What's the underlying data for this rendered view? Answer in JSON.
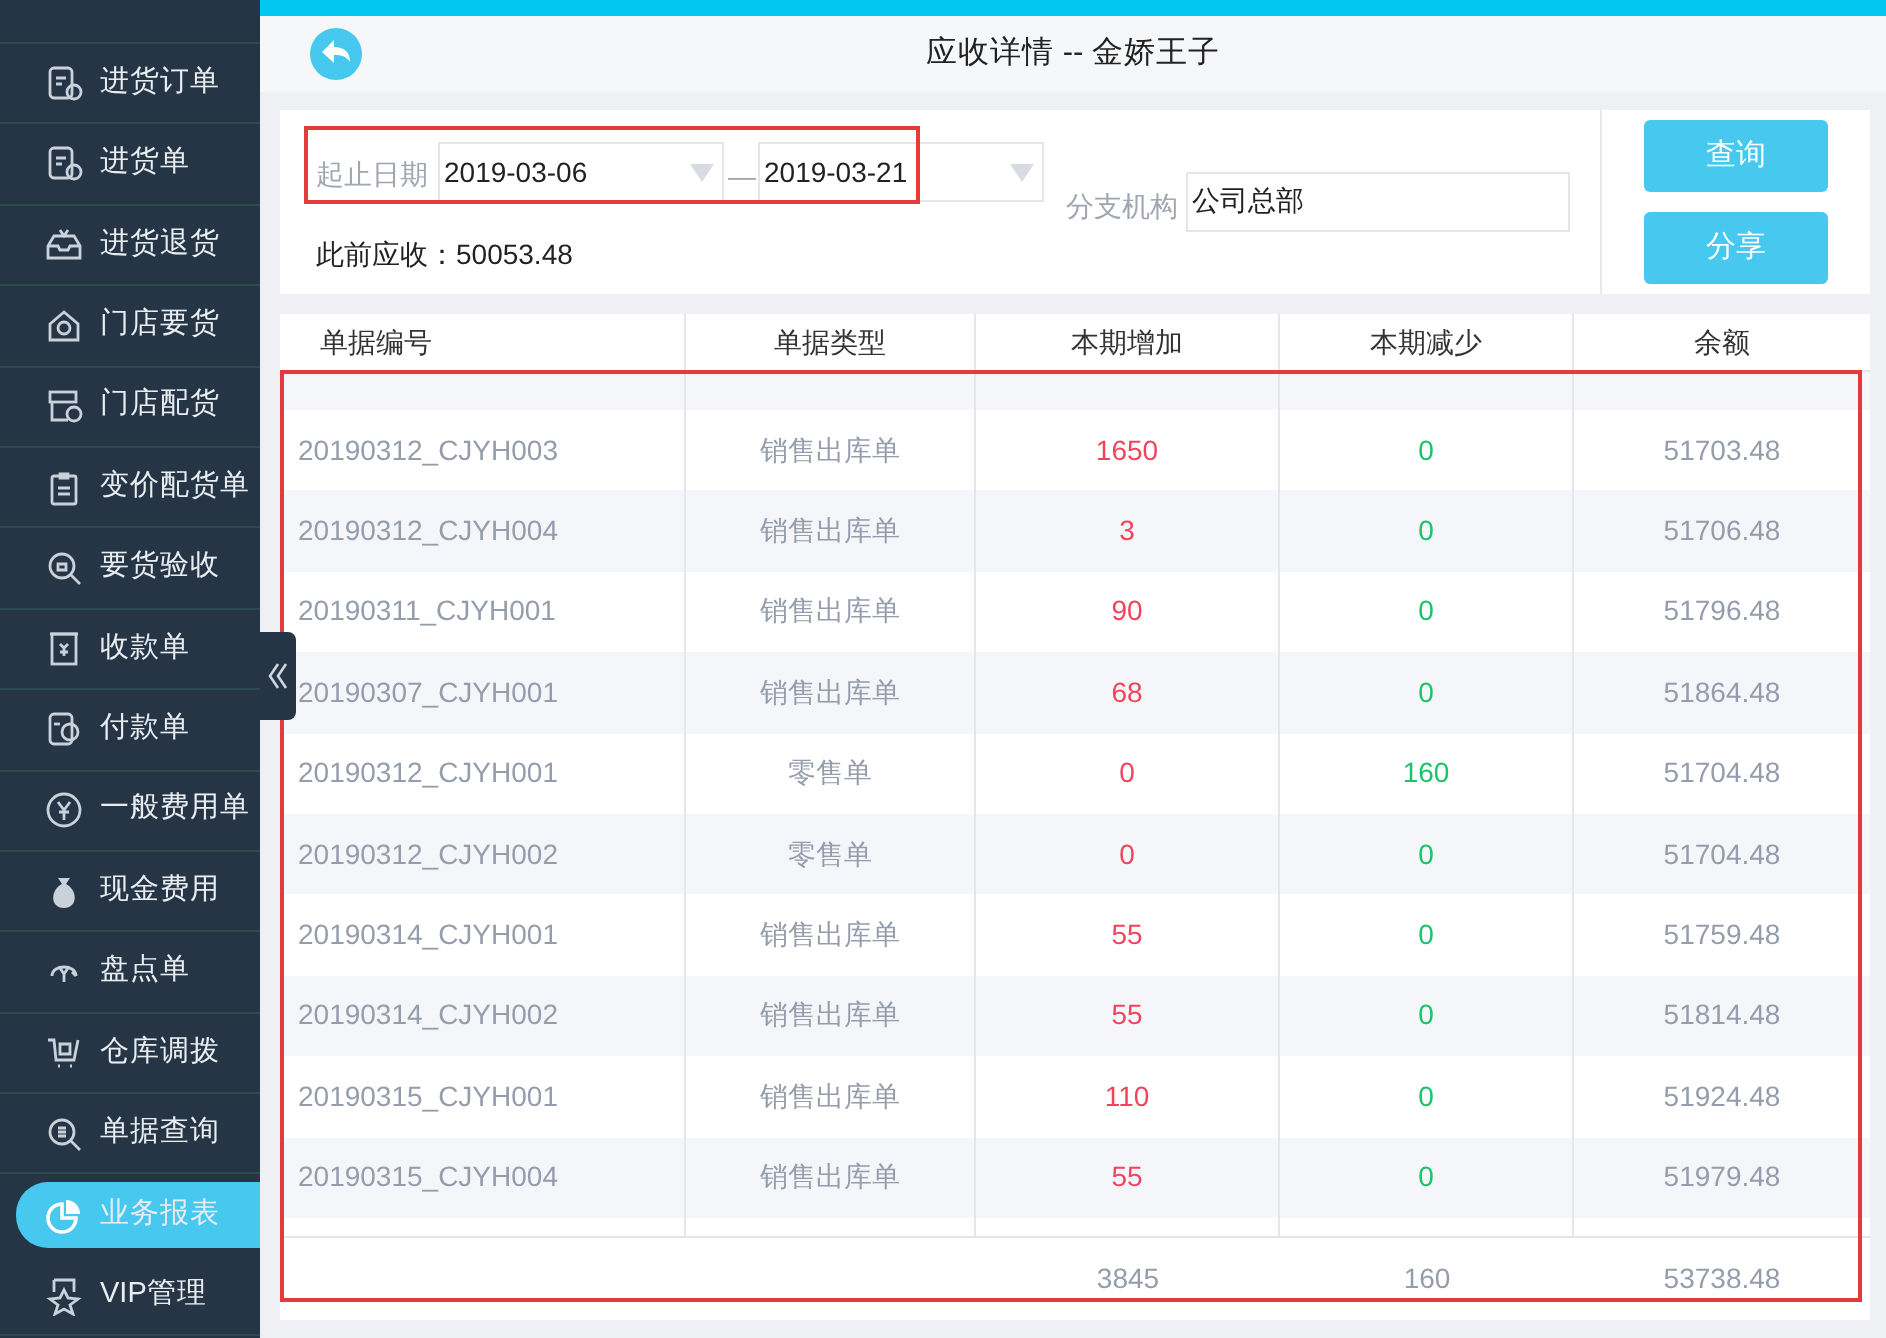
{
  "sidebar": {
    "items": [
      {
        "label": "进货订单",
        "selected": false
      },
      {
        "label": "进货单",
        "selected": false
      },
      {
        "label": "进货退货",
        "selected": false
      },
      {
        "label": "门店要货",
        "selected": false
      },
      {
        "label": "门店配货",
        "selected": false
      },
      {
        "label": "变价配货单",
        "selected": false
      },
      {
        "label": "要货验收",
        "selected": false
      },
      {
        "label": "收款单",
        "selected": false
      },
      {
        "label": "付款单",
        "selected": false
      },
      {
        "label": "一般费用单",
        "selected": false
      },
      {
        "label": "现金费用",
        "selected": false
      },
      {
        "label": "盘点单",
        "selected": false
      },
      {
        "label": "仓库调拨",
        "selected": false
      },
      {
        "label": "单据查询",
        "selected": false
      },
      {
        "label": "业务报表",
        "selected": true
      },
      {
        "label": "VIP管理",
        "selected": false
      }
    ]
  },
  "header": {
    "title": "应收详情 -- 金娇王子"
  },
  "filters": {
    "date_label": "起止日期",
    "start_date": "2019-03-06",
    "separator": "—",
    "end_date": "2019-03-21",
    "branch_label": "分支机构",
    "branch_value": "公司总部",
    "prior_label": "此前应收：",
    "prior_value": "50053.48"
  },
  "buttons": [
    "查询",
    "分享"
  ],
  "table": {
    "columns": [
      "单据编号",
      "单据类型",
      "本期增加",
      "本期减少",
      "余额"
    ],
    "rows": [
      {
        "number": "20190312_CJYH003",
        "type": "销售出库单",
        "increase": "1650",
        "decrease": "0",
        "balance": "51703.48"
      },
      {
        "number": "20190312_CJYH004",
        "type": "销售出库单",
        "increase": "3",
        "decrease": "0",
        "balance": "51706.48"
      },
      {
        "number": "20190311_CJYH001",
        "type": "销售出库单",
        "increase": "90",
        "decrease": "0",
        "balance": "51796.48"
      },
      {
        "number": "20190307_CJYH001",
        "type": "销售出库单",
        "increase": "68",
        "decrease": "0",
        "balance": "51864.48"
      },
      {
        "number": "20190312_CJYH001",
        "type": "零售单",
        "increase": "0",
        "decrease": "160",
        "balance": "51704.48"
      },
      {
        "number": "20190312_CJYH002",
        "type": "零售单",
        "increase": "0",
        "decrease": "0",
        "balance": "51704.48"
      },
      {
        "number": "20190314_CJYH001",
        "type": "销售出库单",
        "increase": "55",
        "decrease": "0",
        "balance": "51759.48"
      },
      {
        "number": "20190314_CJYH002",
        "type": "销售出库单",
        "increase": "55",
        "decrease": "0",
        "balance": "51814.48"
      },
      {
        "number": "20190315_CJYH001",
        "type": "销售出库单",
        "increase": "110",
        "decrease": "0",
        "balance": "51924.48"
      },
      {
        "number": "20190315_CJYH004",
        "type": "销售出库单",
        "increase": "55",
        "decrease": "0",
        "balance": "51979.48"
      }
    ],
    "totals": {
      "increase": "3845",
      "decrease": "160",
      "balance": "53738.48"
    }
  }
}
